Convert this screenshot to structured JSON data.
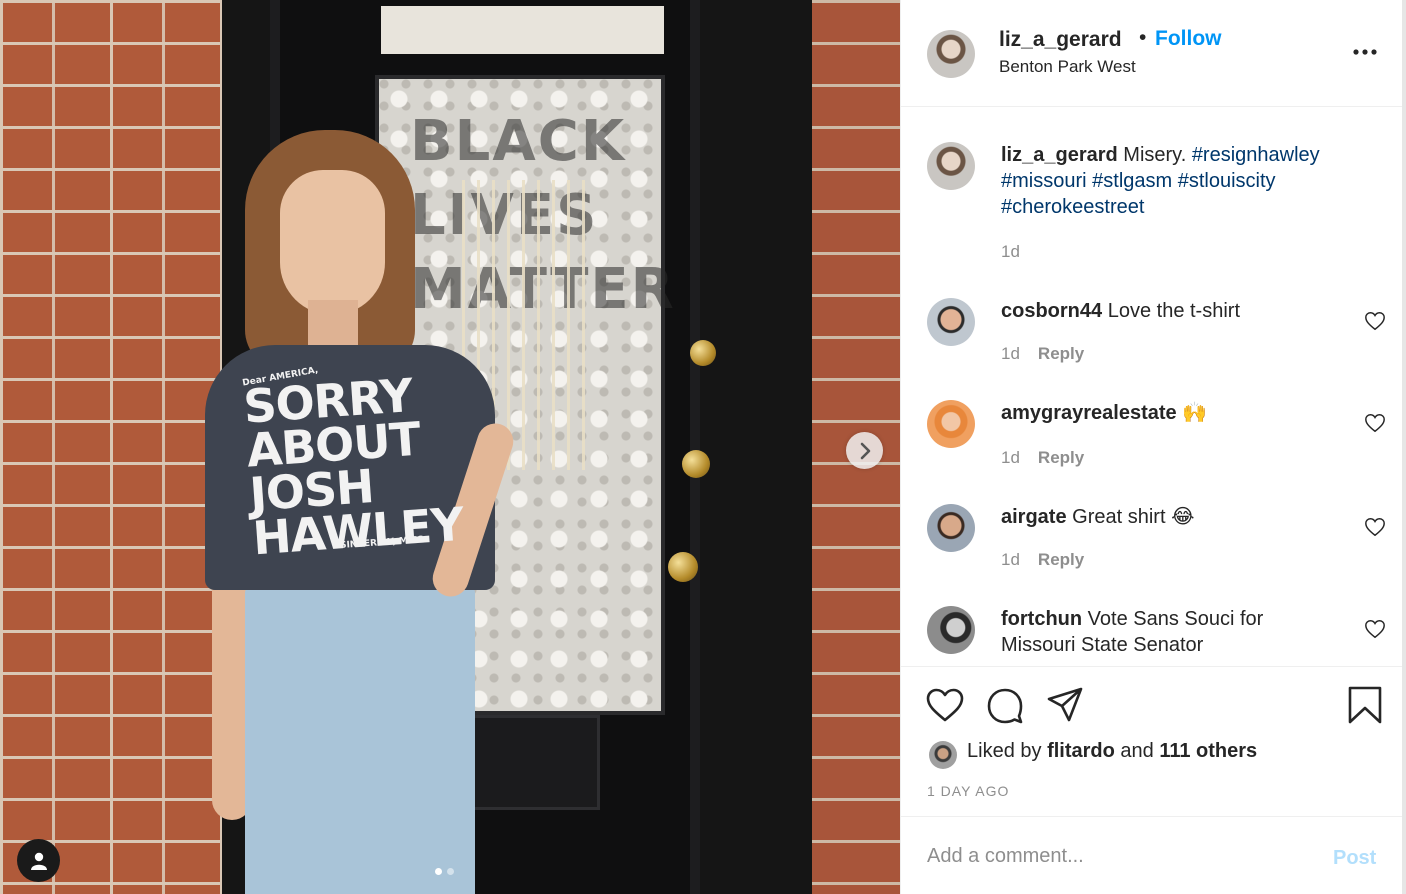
{
  "photo": {
    "window_text": "BLACK LIVES MATTER",
    "shirt_top": "Dear AMERICA,",
    "shirt_main": "SORRY ABOUT JOSH HAWLEY",
    "shirt_sign": "SINCERELY, MISS",
    "next_icon": "chevron-right-icon",
    "carousel": {
      "count": 2,
      "active": 1
    }
  },
  "header": {
    "username": "liz_a_gerard",
    "separator": "•",
    "follow": "Follow",
    "location": "Benton Park West",
    "more": "•••"
  },
  "caption": {
    "username": "liz_a_gerard",
    "text": " Misery. ",
    "tags": [
      "#resignhawley",
      "#missouri",
      "#stlgasm",
      "#stlouiscity",
      "#cherokeestreet"
    ],
    "time": "1d"
  },
  "comments": [
    {
      "username": "cosborn44",
      "text": " Love the t-shirt",
      "time": "1d",
      "reply": "Reply"
    },
    {
      "username": "amygrayrealestate",
      "text": " 🙌",
      "time": "1d",
      "reply": "Reply"
    },
    {
      "username": "airgate",
      "text": " Great shirt 😂",
      "time": "1d",
      "reply": "Reply"
    },
    {
      "username": "fortchun",
      "text": " Vote Sans Souci for Missouri State Senator",
      "time": "",
      "reply": ""
    }
  ],
  "actions": {
    "liked_prefix": "Liked by ",
    "liked_user": "flitardo",
    "liked_mid": " and ",
    "liked_others": "111 others",
    "time_ago": "1 DAY AGO"
  },
  "add_comment": {
    "placeholder": "Add a comment...",
    "post": "Post"
  },
  "colors": {
    "accent": "#0095f6",
    "hashtag": "#00376b",
    "muted": "#8e8e8e",
    "post_disabled": "#b2dffc"
  }
}
